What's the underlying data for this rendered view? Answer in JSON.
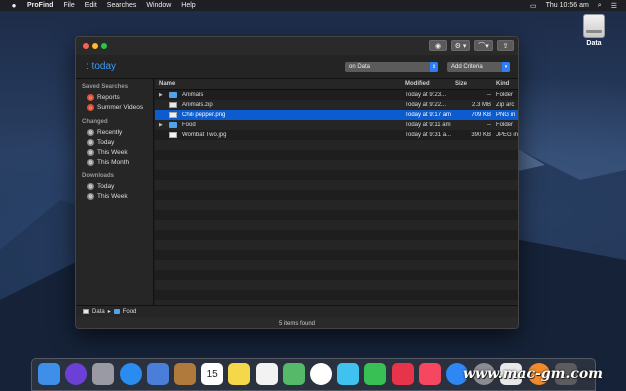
{
  "menubar": {
    "apple_icon": "apple-logo-icon",
    "app_name": "ProFind",
    "items": [
      "File",
      "Edit",
      "Searches",
      "Window",
      "Help"
    ],
    "clock": "Thu 10:56 am"
  },
  "desktop": {
    "drive_label": "Data"
  },
  "window": {
    "title": ": today",
    "toolbar": {
      "eye": "◉",
      "gear": "⚙ ▾",
      "share": "⇪"
    },
    "scope_popup": "on  Data",
    "criteria_popup": "Add Criteria",
    "sidebar": {
      "saved_searches": {
        "heading": "Saved Searches",
        "items": [
          "Reports",
          "Summer Videos"
        ]
      },
      "changed": {
        "heading": "Changed",
        "items": [
          "Recently",
          "Today",
          "This Week",
          "This Month"
        ]
      },
      "downloads": {
        "heading": "Downloads",
        "items": [
          "Today",
          "This Week"
        ]
      }
    },
    "columns": {
      "name": "Name",
      "modified": "Modified",
      "size": "Size",
      "kind": "Kind"
    },
    "rows": [
      {
        "name": "Animals",
        "modified": "Today at 9:23...",
        "size": "--",
        "kind": "Folder",
        "type": "folder",
        "disclosure": "▶"
      },
      {
        "name": "Animals.zip",
        "modified": "Today at 9:22...",
        "size": "2.3 MB",
        "kind": "Zip arc",
        "type": "zip",
        "disclosure": ""
      },
      {
        "name": "Chili pepper.png",
        "modified": "Today at 9:17 am",
        "size": "709 KB",
        "kind": "PNG in",
        "type": "image",
        "disclosure": ""
      },
      {
        "name": "Food",
        "modified": "Today at 9:11 am",
        "size": "--",
        "kind": "Folder",
        "type": "folder",
        "disclosure": "▶"
      },
      {
        "name": "Wombat Two.jpg",
        "modified": "Today at 9:31 a...",
        "size": "390 KB",
        "kind": "JPEG in",
        "type": "image",
        "disclosure": ""
      }
    ],
    "path": {
      "root": "Data",
      "separator": "▸",
      "child": "Food"
    },
    "status": "5 items found"
  },
  "dock": {
    "apps": [
      "finder-icon",
      "siri-icon",
      "launchpad-icon",
      "safari-icon",
      "mail-icon",
      "contacts-icon",
      "calendar-icon",
      "notes-icon",
      "reminders-icon",
      "maps-icon",
      "photos-icon",
      "messages-icon",
      "facetime-icon",
      "news-icon",
      "music-icon",
      "app-store-icon",
      "system-preferences-icon",
      "preview-icon",
      "profind-icon",
      "trash-icon"
    ],
    "calendar_day": "15"
  },
  "watermark": "www.mac-gm.com",
  "colors": {
    "accent": "#2f7df5",
    "title_blue": "#3b9cf6",
    "selection": "#0c5ccf",
    "folder": "#4fa3e6"
  }
}
